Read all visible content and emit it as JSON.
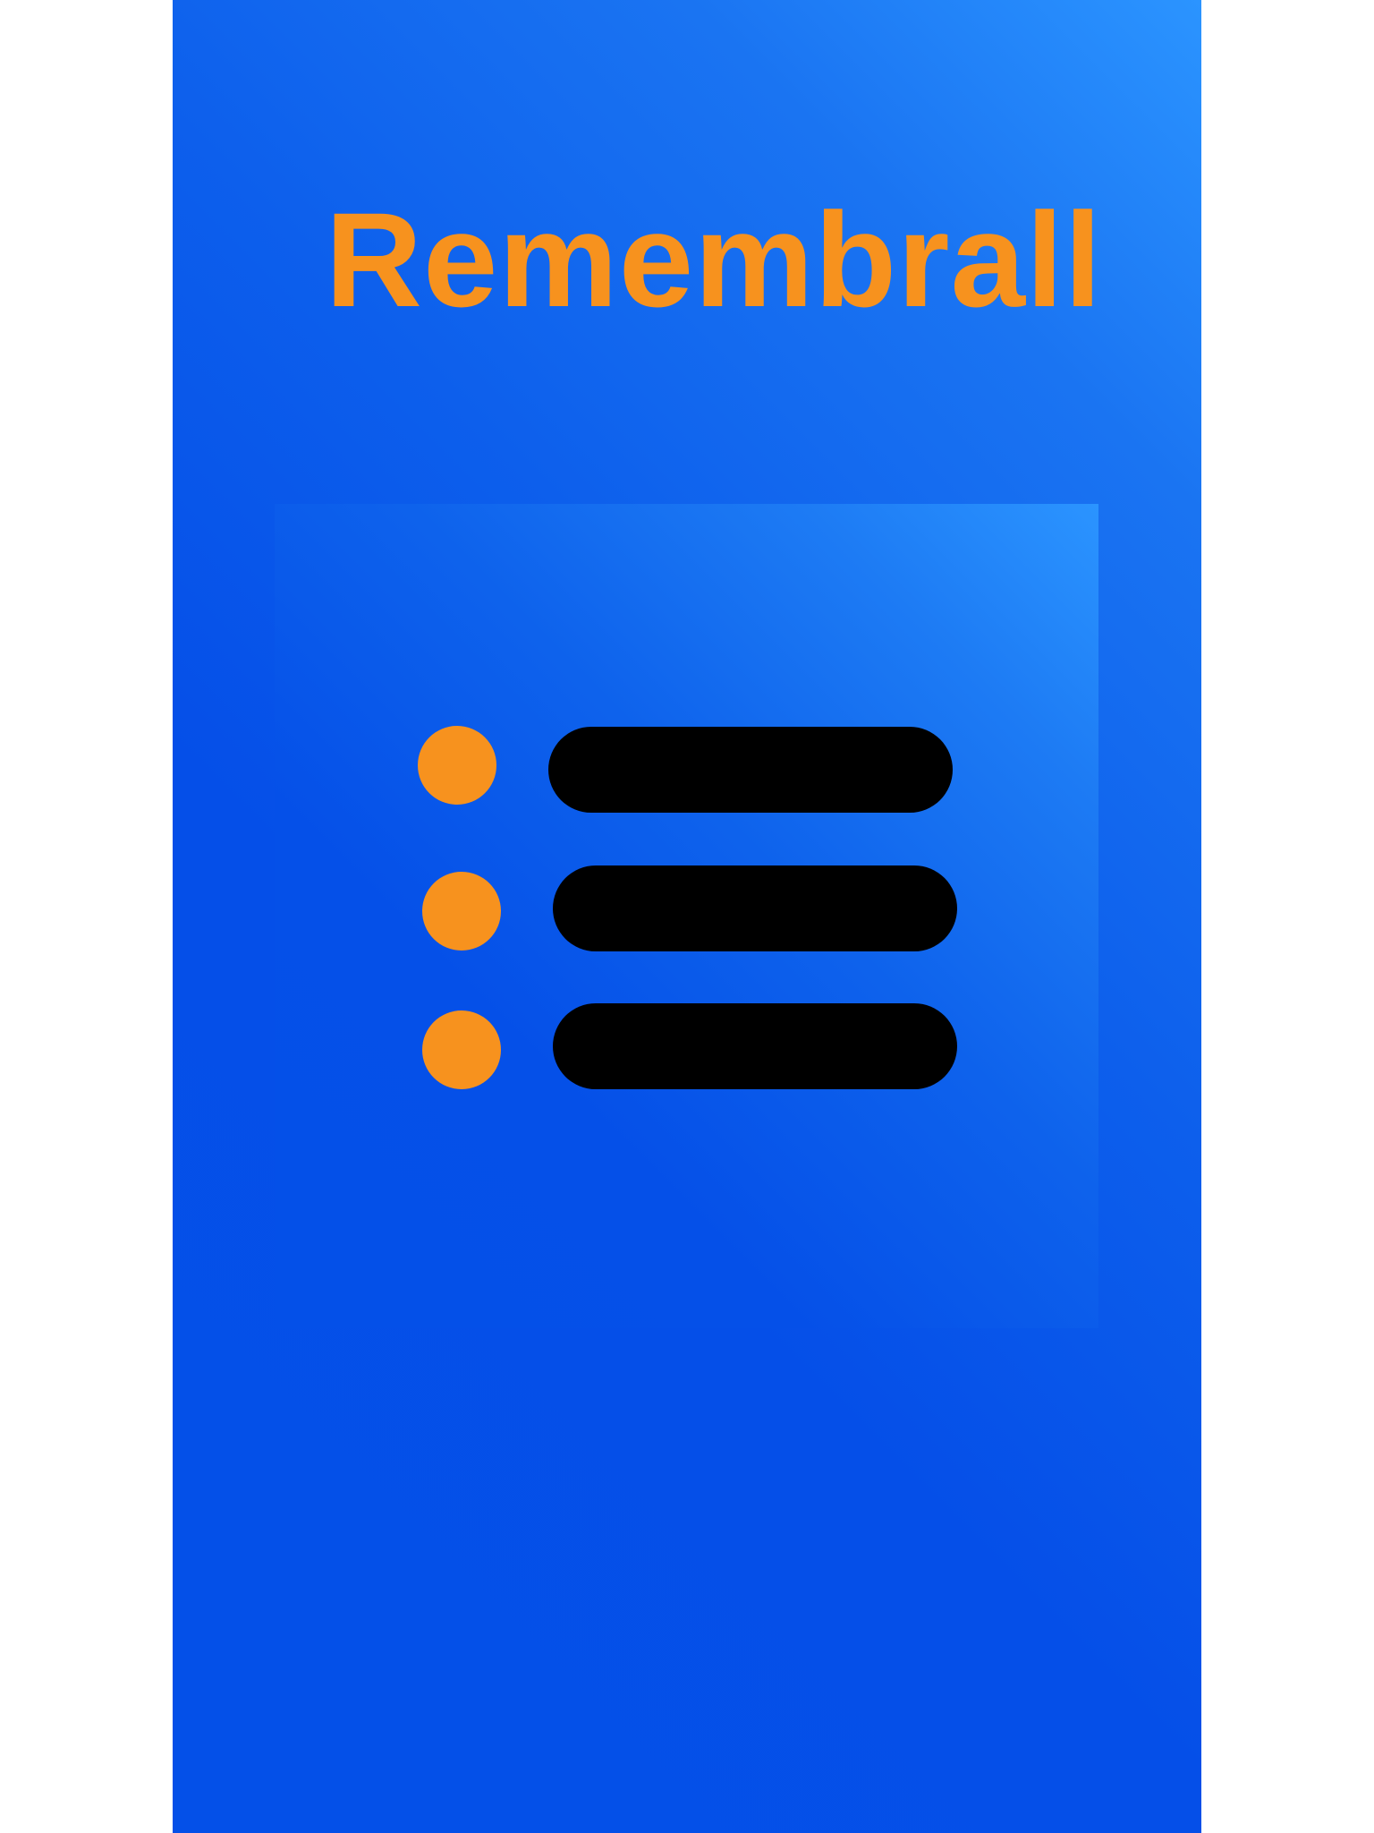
{
  "app": {
    "title": "Remembrall"
  },
  "logo": {
    "icon": "list-icon",
    "bullet_color": "#f7921e",
    "bar_color": "#000000"
  },
  "colors": {
    "background_top": "#2b94ff",
    "background_bottom": "#0450e8",
    "accent": "#f7921e"
  }
}
